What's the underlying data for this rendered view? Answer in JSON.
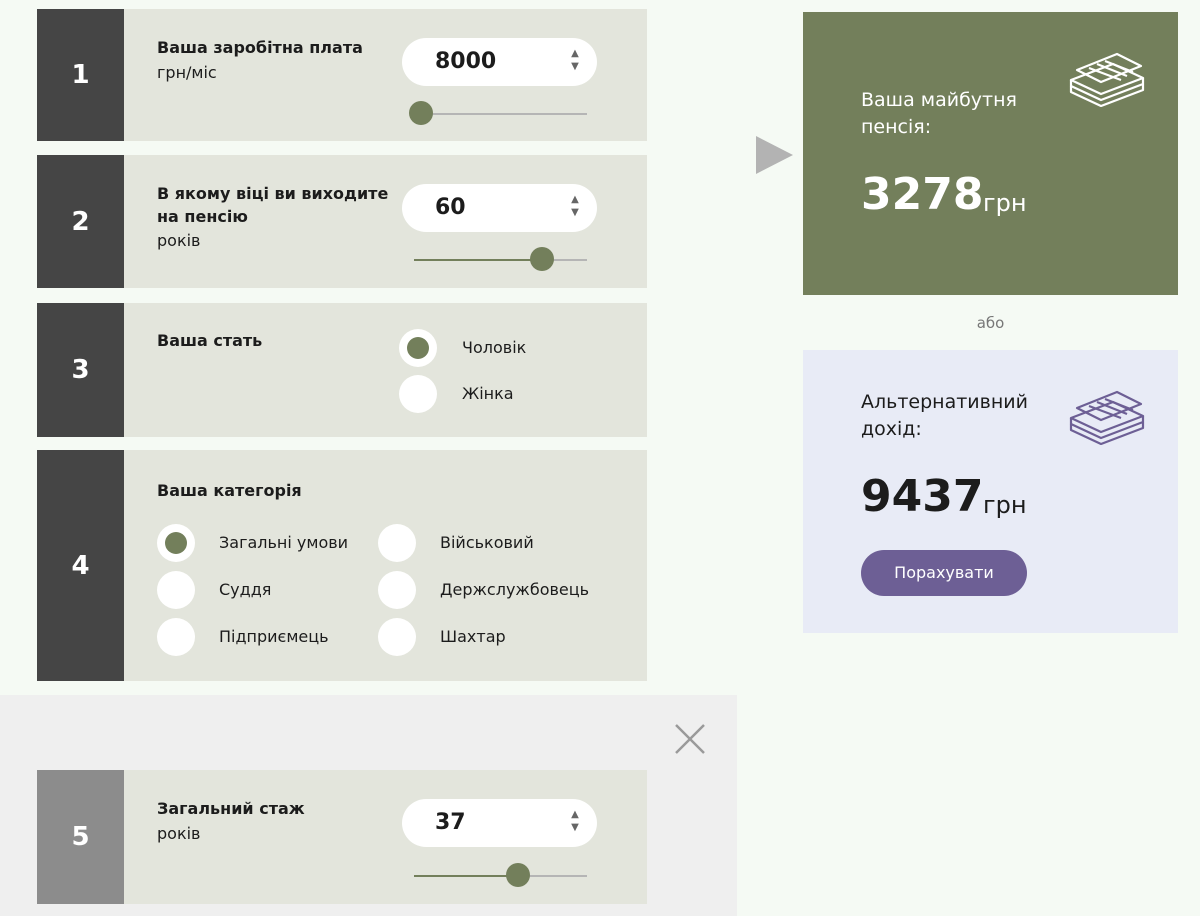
{
  "cards": {
    "salary": {
      "number": "1",
      "title": "Ваша заробітна плата",
      "unit": "грн/міс",
      "value": "8000",
      "slider_fraction": 0.04
    },
    "age": {
      "number": "2",
      "title": "В якому віці ви виходите на пенсію",
      "unit": "років",
      "value": "60",
      "slider_fraction": 0.74
    },
    "gender": {
      "number": "3",
      "title": "Ваша стать",
      "options": [
        {
          "label": "Чоловік",
          "selected": true
        },
        {
          "label": "Жінка",
          "selected": false
        }
      ]
    },
    "category": {
      "number": "4",
      "title": "Ваша категорія",
      "options": [
        {
          "label": "Загальні умови",
          "selected": true
        },
        {
          "label": "Військовий",
          "selected": false
        },
        {
          "label": "Суддя",
          "selected": false
        },
        {
          "label": "Держслужбовець",
          "selected": false
        },
        {
          "label": "Підприємець",
          "selected": false
        },
        {
          "label": "Шахтар",
          "selected": false
        }
      ]
    },
    "experience": {
      "number": "5",
      "title": "Загальний стаж",
      "unit": "років",
      "value": "37",
      "slider_fraction": 0.6
    }
  },
  "stepper_arrows": {
    "up": "▲",
    "down": "▼"
  },
  "results": {
    "pension": {
      "title": "Ваша майбутня пенсія:",
      "value": "3278",
      "unit": "грн"
    },
    "or": "або",
    "alternative": {
      "title": "Альтернативний дохід:",
      "value": "9437",
      "unit": "грн",
      "button": "Порахувати"
    }
  },
  "colors": {
    "accent_green": "#737f5b",
    "accent_purple": "#6d5f95",
    "card_bg": "#e3e5dc",
    "number_bg": "#454545"
  }
}
